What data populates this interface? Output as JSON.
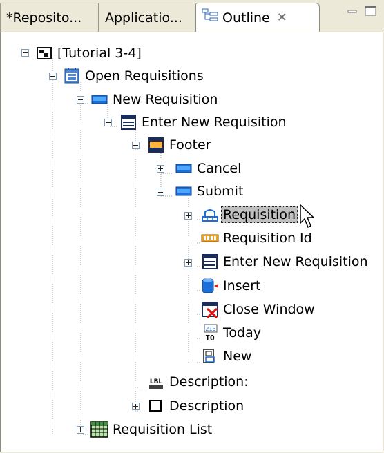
{
  "tabs": [
    {
      "label": "*Reposito...",
      "active": false
    },
    {
      "label": "Applicatio...",
      "active": false
    },
    {
      "label": "Outline",
      "active": true,
      "close": "✕"
    }
  ],
  "tree": {
    "root": "[Tutorial 3-4]",
    "open_requisitions": "Open Requisitions",
    "new_requisition": "New Requisition",
    "enter_new_requisition": "Enter New Requisition",
    "footer": "Footer",
    "cancel": "Cancel",
    "submit": "Submit",
    "requisition": "Requisition",
    "requisition_id": "Requisition Id",
    "enter_new_requisition_2": "Enter New Requisition",
    "insert": "Insert",
    "close_window": "Close Window",
    "today": "Today",
    "new": "New",
    "description_label": "Description:",
    "description": "Description",
    "requisition_list": "Requisition List"
  },
  "icons": {
    "today_badge": "213",
    "today_to": "TO",
    "lbl_badge": "LBL"
  },
  "colors": {
    "selection_bg": "#c0c0c0",
    "tree_line": "#a0a0a0",
    "button_blue": "#1b6fd6"
  }
}
